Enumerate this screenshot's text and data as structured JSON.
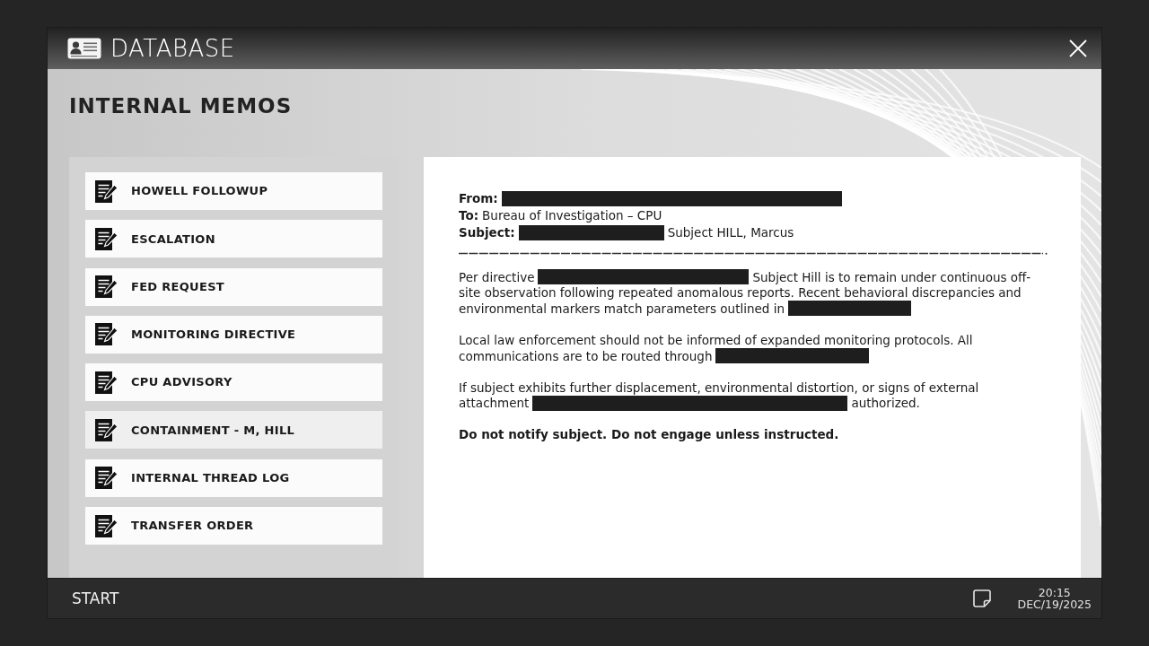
{
  "window": {
    "title": "DATABASE"
  },
  "page": {
    "heading": "INTERNAL MEMOS"
  },
  "memo_list": [
    {
      "label": "HOWELL FOLLOWUP",
      "selected": false
    },
    {
      "label": "ESCALATION",
      "selected": false
    },
    {
      "label": "FED REQUEST",
      "selected": false
    },
    {
      "label": "MONITORING DIRECTIVE",
      "selected": false
    },
    {
      "label": "CPU ADVISORY",
      "selected": false
    },
    {
      "label": "CONTAINMENT - M, HILL",
      "selected": true
    },
    {
      "label": "INTERNAL THREAD LOG",
      "selected": false
    },
    {
      "label": "TRANSFER ORDER",
      "selected": false
    }
  ],
  "memo": {
    "blocks": [
      {
        "kind": "header",
        "lines": [
          {
            "segments": [
              {
                "kind": "bold",
                "text": "From:"
              },
              {
                "kind": "redacted"
              }
            ]
          },
          {
            "segments": [
              {
                "kind": "bold",
                "text": "To:"
              },
              {
                "kind": "text",
                "text": "Bureau of Investigation – CPU"
              }
            ]
          },
          {
            "segments": [
              {
                "kind": "bold",
                "text": "Subject:"
              },
              {
                "kind": "redacted"
              },
              {
                "kind": "text",
                "text": "Subject HILL, Marcus"
              }
            ]
          }
        ]
      },
      {
        "kind": "divider"
      },
      {
        "kind": "paragraph",
        "lines": [
          {
            "segments": [
              {
                "kind": "text",
                "text": "Per directive"
              },
              {
                "kind": "redacted"
              },
              {
                "kind": "text",
                "text": "Subject Hill is to remain under continuous off-"
              }
            ]
          },
          {
            "segments": [
              {
                "kind": "text",
                "text": "site observation following repeated anomalous reports. Recent behavioral discrepancies and"
              }
            ]
          },
          {
            "segments": [
              {
                "kind": "text",
                "text": "environmental markers match parameters outlined in"
              },
              {
                "kind": "redacted"
              }
            ]
          }
        ]
      },
      {
        "kind": "paragraph",
        "lines": [
          {
            "segments": [
              {
                "kind": "text",
                "text": "Local law enforcement should not be informed of expanded monitoring protocols. All"
              }
            ]
          },
          {
            "segments": [
              {
                "kind": "text",
                "text": "communications are to be routed through"
              },
              {
                "kind": "redacted"
              }
            ]
          }
        ]
      },
      {
        "kind": "paragraph",
        "lines": [
          {
            "segments": [
              {
                "kind": "text",
                "text": "If subject exhibits further displacement, environmental distortion, or signs of external"
              }
            ]
          },
          {
            "segments": [
              {
                "kind": "text",
                "text": "attachment"
              },
              {
                "kind": "redacted"
              },
              {
                "kind": "text",
                "text": "authorized."
              }
            ]
          }
        ]
      },
      {
        "kind": "paragraph",
        "lines": [
          {
            "segments": [
              {
                "kind": "bold",
                "text": "Do not notify subject. Do not engage unless instructed."
              }
            ]
          }
        ]
      }
    ]
  },
  "taskbar": {
    "start": "START",
    "time": "20:15",
    "date": "DEC/19/2025"
  }
}
